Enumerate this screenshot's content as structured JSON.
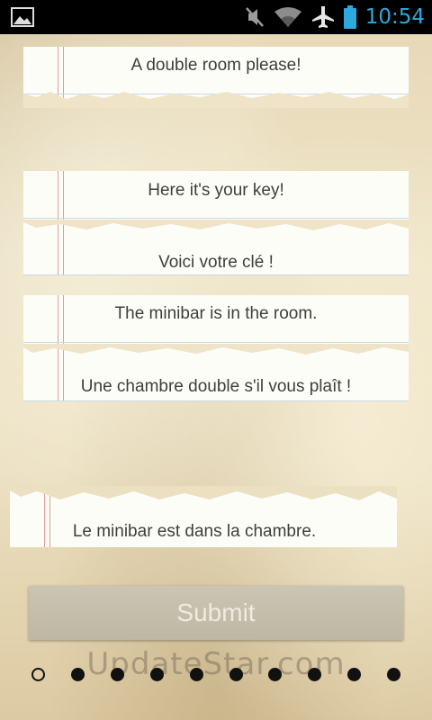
{
  "status_bar": {
    "time": "10:54",
    "icons": [
      "image-icon",
      "mute-icon",
      "wifi-icon",
      "airplane-icon",
      "battery-icon"
    ]
  },
  "cards": {
    "english_1": "A double room please!",
    "english_2": "Here it's your key!",
    "french_1": "Voici votre clé !",
    "english_3": "The minibar is in the room.",
    "french_2": "Une chambre double s'il vous plaît !",
    "french_3": "Le minibar est dans la chambre."
  },
  "submit": {
    "label": "Submit"
  },
  "watermark": "UpdateStar.com",
  "pager": {
    "total": 10,
    "current": 1
  },
  "colors": {
    "clock": "#2ea9dd",
    "paper": "#fdfdf8",
    "margin_line": "#e49a9a",
    "rule_line": "#c7d9e8"
  }
}
